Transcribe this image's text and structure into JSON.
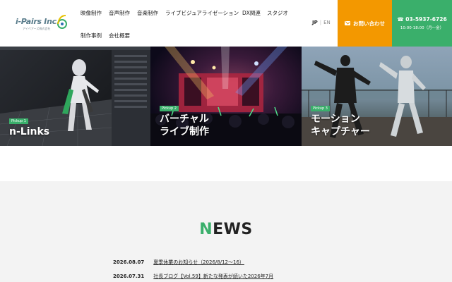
{
  "header": {
    "logo_text": "i-Pairs Inc.",
    "logo_sub": "アイペアーズ株式会社",
    "nav": [
      {
        "label": "映像制作"
      },
      {
        "label": "音声制作"
      },
      {
        "label": "音楽制作"
      },
      {
        "label": "ライブビジュアライゼーション"
      },
      {
        "label": "DX関連"
      },
      {
        "label": "スタジオ"
      },
      {
        "label": "制作事例"
      },
      {
        "label": "会社概要"
      }
    ],
    "lang": {
      "jp": "JP",
      "sep": "|",
      "en": "EN"
    },
    "contact_label": "お問い合わせ",
    "tel": {
      "number": "☎ 03-5937-6726",
      "hours": "10:00-18:00（月〜金）"
    }
  },
  "hero": {
    "panels": [
      {
        "pickup": "Pickup 1",
        "title_lines": [
          "n-Links"
        ]
      },
      {
        "pickup": "Pickup 2",
        "title_lines": [
          "バーチャル",
          "ライブ制作"
        ]
      },
      {
        "pickup": "Pickup 3",
        "title_lines": [
          "モーション",
          "キャプチャー"
        ]
      }
    ]
  },
  "news": {
    "heading_first": "N",
    "heading_rest": "EWS",
    "items": [
      {
        "date": "2026.08.07",
        "title": "夏季休業のお知らせ（2026/8/12〜16）"
      },
      {
        "date": "2026.07.31",
        "title": "社長ブログ【Vol.59】新たな発表が続いた2026年7月"
      }
    ]
  },
  "colors": {
    "accent_green": "#3aaf6b",
    "contact_orange": "#f39800",
    "news_bg": "#f3f3f3"
  }
}
